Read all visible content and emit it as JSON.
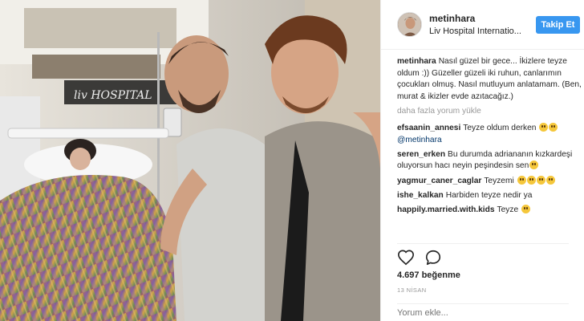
{
  "post": {
    "username": "metinhara",
    "location": "Liv Hospital Internatio...",
    "follow_label": "Takip Et",
    "comments": [
      {
        "user": "metinhara",
        "segments": [
          {
            "t": "Nasıl güzel bir gece... İkizlere teyze oldum :)) Güzeller güzeli iki ruhun, canlarımın çocukları olmuş. Nasıl mutluyum anlatamam. (Ben, murat & ikizler evde azıtacağız.)"
          }
        ]
      },
      {
        "load_more": "daha fazla yorum yükle"
      },
      {
        "user": "efsaanin_annesi",
        "segments": [
          {
            "t": "Teyze oldum derken "
          },
          {
            "emoji": "crying-face-emoji"
          },
          {
            "emoji": "crying-face-emoji"
          },
          {
            "mention": "@metinhara"
          }
        ]
      },
      {
        "user": "seren_erken",
        "segments": [
          {
            "t": "Bu durumda adriananın kızkardeşi oluyorsun hacı neyin peşindesin sen"
          },
          {
            "emoji": "grinning-face-emoji"
          }
        ]
      },
      {
        "user": "yagmur_caner_caglar",
        "segments": [
          {
            "t": "Teyzemi "
          },
          {
            "emoji": "crying-face-emoji"
          },
          {
            "emoji": "crying-face-emoji"
          },
          {
            "emoji": "crying-face-emoji"
          },
          {
            "emoji": "crying-face-emoji"
          }
        ]
      },
      {
        "user": "ishe_kalkan",
        "segments": [
          {
            "t": "Harbiden teyze nedir ya"
          }
        ]
      },
      {
        "user": "happily.married.with.kids",
        "segments": [
          {
            "t": "Teyze "
          },
          {
            "emoji": "grinning-face-emoji"
          }
        ]
      }
    ],
    "likes": "4.697 beğenme",
    "date": "13 NİSAN",
    "add_comment_placeholder": "Yorum ekle..."
  },
  "photo": {
    "wall_sign": "liv HOSPITAL",
    "bed_label": "",
    "icons": [
      "heart-icon",
      "comment-icon"
    ]
  },
  "colors": {
    "follow_button": "#3897f0",
    "mention": "#003569",
    "muted": "#999999"
  }
}
